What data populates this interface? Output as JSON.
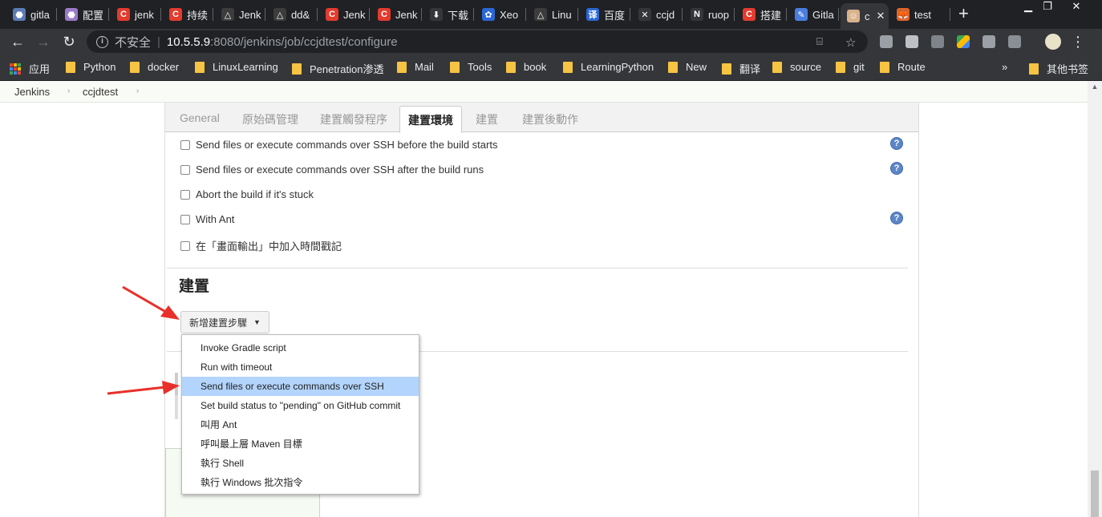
{
  "tabs": [
    {
      "title": "gitla",
      "color": "#5b7bb5",
      "glyph": "⬣"
    },
    {
      "title": "配置",
      "color": "#9b7bc9",
      "glyph": "⬣"
    },
    {
      "title": "jenk",
      "color": "#e33b2e",
      "glyph": "C"
    },
    {
      "title": "持续",
      "color": "#e33b2e",
      "glyph": "C"
    },
    {
      "title": "Jenk",
      "color": "#3c3c3c",
      "glyph": "△"
    },
    {
      "title": "dd&",
      "color": "#3c3c3c",
      "glyph": "△"
    },
    {
      "title": "Jenk",
      "color": "#e33b2e",
      "glyph": "C"
    },
    {
      "title": "Jenk",
      "color": "#e33b2e",
      "glyph": "C"
    },
    {
      "title": "下载",
      "color": "#35363a",
      "glyph": "⬇"
    },
    {
      "title": "Xeo",
      "color": "#2b67d6",
      "glyph": "✿"
    },
    {
      "title": "Linu",
      "color": "#3c3c3c",
      "glyph": "△"
    },
    {
      "title": "百度",
      "color": "#2b67d6",
      "glyph": "译"
    },
    {
      "title": "ccjd",
      "color": "#35363a",
      "glyph": "✕"
    },
    {
      "title": "ruop",
      "color": "#35363a",
      "glyph": "N"
    },
    {
      "title": "搭建",
      "color": "#e33b2e",
      "glyph": "C"
    },
    {
      "title": "Gitla",
      "color": "#4a7de0",
      "glyph": "✎"
    },
    {
      "title": "c",
      "color": "#d9b38c",
      "glyph": "☺"
    },
    {
      "title": "test",
      "color": "#e2622a",
      "glyph": "🦊"
    }
  ],
  "address": {
    "security_label": "不安全",
    "host": "10.5.5.9",
    "path": ":8080/jenkins/job/ccjdtest/configure"
  },
  "bookmarks": [
    {
      "label": "应用",
      "type": "apps"
    },
    {
      "label": "Python",
      "type": "folder"
    },
    {
      "label": "docker",
      "type": "folder"
    },
    {
      "label": "LinuxLearning",
      "type": "folder"
    },
    {
      "label": "Penetration渗透",
      "type": "folder"
    },
    {
      "label": "Mail",
      "type": "folder"
    },
    {
      "label": "Tools",
      "type": "folder"
    },
    {
      "label": "book",
      "type": "folder"
    },
    {
      "label": "LearningPython",
      "type": "folder"
    },
    {
      "label": "New",
      "type": "folder"
    },
    {
      "label": "翻译",
      "type": "folder"
    },
    {
      "label": "source",
      "type": "folder"
    },
    {
      "label": "git",
      "type": "folder"
    },
    {
      "label": "Route",
      "type": "folder"
    }
  ],
  "bookmarks_overflow": "»",
  "other_bookmarks": "其他书签",
  "breadcrumb": [
    "Jenkins",
    "ccjdtest"
  ],
  "config_tabs": [
    "General",
    "原始碼管理",
    "建置觸發程序",
    "建置環境",
    "建置",
    "建置後動作"
  ],
  "active_config_tab": "建置環境",
  "build_env_options": [
    {
      "label": "Send files or execute commands over SSH before the build starts",
      "checked": false,
      "help": true
    },
    {
      "label": "Send files or execute commands over SSH after the build runs",
      "checked": false,
      "help": true
    },
    {
      "label": "Abort the build if it's stuck",
      "checked": false,
      "help": false
    },
    {
      "label": "With Ant",
      "checked": false,
      "help": true
    },
    {
      "label": "在「畫面輸出」中加入時間戳記",
      "checked": false,
      "help": false
    }
  ],
  "build_section_title": "建置",
  "add_build_step_label": "新增建置步驟",
  "build_step_menu": [
    {
      "label": "Invoke Gradle script",
      "highlighted": false
    },
    {
      "label": "Run with timeout",
      "highlighted": false
    },
    {
      "label": "Send files or execute commands over SSH",
      "highlighted": true
    },
    {
      "label": "Set build status to \"pending\" on GitHub commit",
      "highlighted": false
    },
    {
      "label": "叫用 Ant",
      "highlighted": false
    },
    {
      "label": "呼叫最上層 Maven 目標",
      "highlighted": false
    },
    {
      "label": "執行 Shell",
      "highlighted": false
    },
    {
      "label": "執行 Windows 批次指令",
      "highlighted": false
    }
  ],
  "annotation_color": "#e8302a",
  "help_glyph": "?"
}
